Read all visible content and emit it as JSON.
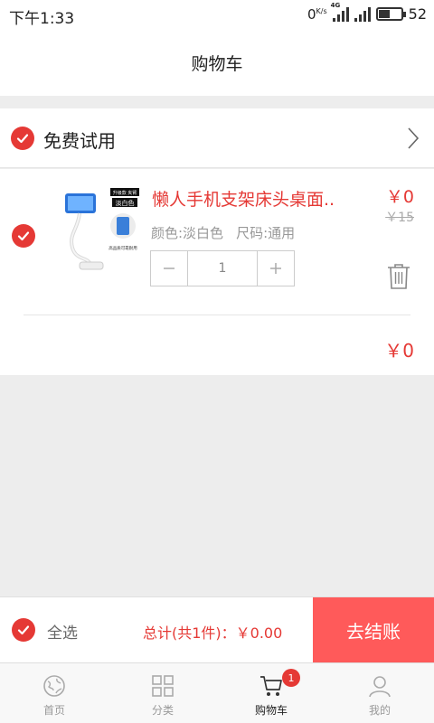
{
  "status_bar": {
    "time": "下午1:33",
    "net_speed": "0",
    "net_unit": "K/s",
    "network_type": "4G",
    "battery": "52",
    "battery_level": 0.52
  },
  "nav": {
    "title": "购物车"
  },
  "trial_section": {
    "label": "免费试用",
    "checked": true
  },
  "item": {
    "title": "懒人手机支架床头桌面..",
    "color_spec": "颜色:淡白色",
    "size_spec": "尺码:通用",
    "price": "￥0",
    "old_price": "￥15",
    "quantity": "1",
    "checked": true,
    "thumb_banner_1": "升级款 夹臂",
    "thumb_banner_2": "淡白色",
    "thumb_caption": "高品质可靠耐用"
  },
  "subtotal": "￥0",
  "bottom_bar": {
    "select_all_label": "全选",
    "total_text": "总计(共1件)：￥0.00",
    "checkout_label": "去结账"
  },
  "tabs": [
    {
      "label": "首页",
      "icon": "globe-icon"
    },
    {
      "label": "分类",
      "icon": "grid-icon"
    },
    {
      "label": "购物车",
      "icon": "cart-icon",
      "badge": "1",
      "active": true
    },
    {
      "label": "我的",
      "icon": "user-icon"
    }
  ],
  "colors": {
    "accent": "#e53935",
    "checkout_bg": "#ff5a5a",
    "page_bg": "#ededed"
  }
}
